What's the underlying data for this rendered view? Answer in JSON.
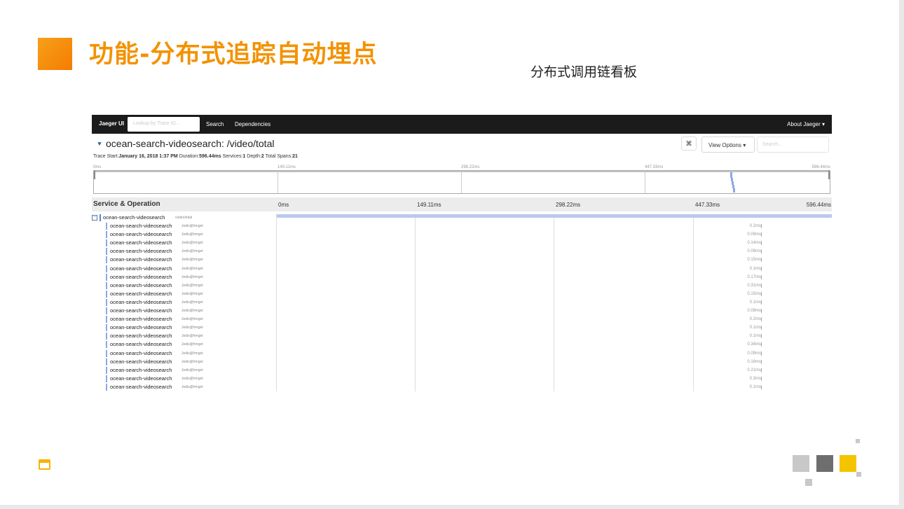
{
  "slide": {
    "title": "功能-分布式追踪自动埋点",
    "subtitle": "分布式调用链看板"
  },
  "colors": {
    "title": "#f39200",
    "accent_square": "#f57c00",
    "deco_light": "#c8c8c8",
    "deco_dark": "#6e6e6e",
    "deco_yellow": "#f5c400",
    "span_bar": "#8ea8e0"
  },
  "jaeger": {
    "nav": {
      "brand": "Jaeger UI",
      "lookup_placeholder": "Lookup by Trace ID...",
      "search": "Search",
      "dependencies": "Dependencies",
      "about": "About Jaeger ▾"
    },
    "trace": {
      "collapse_icon": "chevron-double-down-icon",
      "title": "ocean-search-videosearch: /video/total",
      "close_label": "⌘",
      "view_options": "View Options ▾",
      "search_placeholder": "Search...",
      "meta": {
        "start_label": "Trace Start:",
        "start_value": "January 16, 2018 1:37 PM",
        "duration_label": "Duration:",
        "duration_value": "596.44ms",
        "services_label": "Services:",
        "services_value": "1",
        "depth_label": "Depth:",
        "depth_value": "2",
        "spans_label": "Total Spans:",
        "spans_value": "21"
      }
    },
    "minimap_ticks": [
      "0ms",
      "149.11ms",
      "298.22ms",
      "447.33ms",
      "596.44ms"
    ],
    "header": {
      "title": "Service & Operation",
      "ticks": [
        "0ms",
        "149.11ms",
        "298.22ms",
        "447.33ms",
        "596.44ms"
      ]
    },
    "root": {
      "service": "ocean-search-videosearch",
      "operation": "/video/total"
    },
    "spans": [
      {
        "service": "ocean-search-videosearch",
        "operation": "Jedis@hmget",
        "duration": "0.2ms"
      },
      {
        "service": "ocean-search-videosearch",
        "operation": "Jedis@hmget",
        "duration": "0.09ms"
      },
      {
        "service": "ocean-search-videosearch",
        "operation": "Jedis@hmget",
        "duration": "0.14ms"
      },
      {
        "service": "ocean-search-videosearch",
        "operation": "Jedis@hmget",
        "duration": "0.09ms"
      },
      {
        "service": "ocean-search-videosearch",
        "operation": "Jedis@hmget",
        "duration": "0.15ms"
      },
      {
        "service": "ocean-search-videosearch",
        "operation": "Jedis@hmget",
        "duration": "0.1ms"
      },
      {
        "service": "ocean-search-videosearch",
        "operation": "Jedis@hmget",
        "duration": "0.17ms"
      },
      {
        "service": "ocean-search-videosearch",
        "operation": "Jedis@hmget",
        "duration": "0.31ms"
      },
      {
        "service": "ocean-search-videosearch",
        "operation": "Jedis@hmget",
        "duration": "0.15ms"
      },
      {
        "service": "ocean-search-videosearch",
        "operation": "Jedis@hmget",
        "duration": "0.1ms"
      },
      {
        "service": "ocean-search-videosearch",
        "operation": "Jedis@hmget",
        "duration": "0.09ms"
      },
      {
        "service": "ocean-search-videosearch",
        "operation": "Jedis@hmget",
        "duration": "0.2ms"
      },
      {
        "service": "ocean-search-videosearch",
        "operation": "Jedis@hmget",
        "duration": "0.1ms"
      },
      {
        "service": "ocean-search-videosearch",
        "operation": "Jedis@hmget",
        "duration": "0.1ms"
      },
      {
        "service": "ocean-search-videosearch",
        "operation": "Jedis@hmget",
        "duration": "0.34ms"
      },
      {
        "service": "ocean-search-videosearch",
        "operation": "Jedis@hmget",
        "duration": "0.09ms"
      },
      {
        "service": "ocean-search-videosearch",
        "operation": "Jedis@hmget",
        "duration": "0.16ms"
      },
      {
        "service": "ocean-search-videosearch",
        "operation": "Jedis@hmget",
        "duration": "0.21ms"
      },
      {
        "service": "ocean-search-videosearch",
        "operation": "Jedis@hmget",
        "duration": "0.3ms"
      },
      {
        "service": "ocean-search-videosearch",
        "operation": "Jedis@hmget",
        "duration": "0.1ms"
      }
    ]
  },
  "footer": {
    "calendar_icon": "calendar-icon"
  }
}
